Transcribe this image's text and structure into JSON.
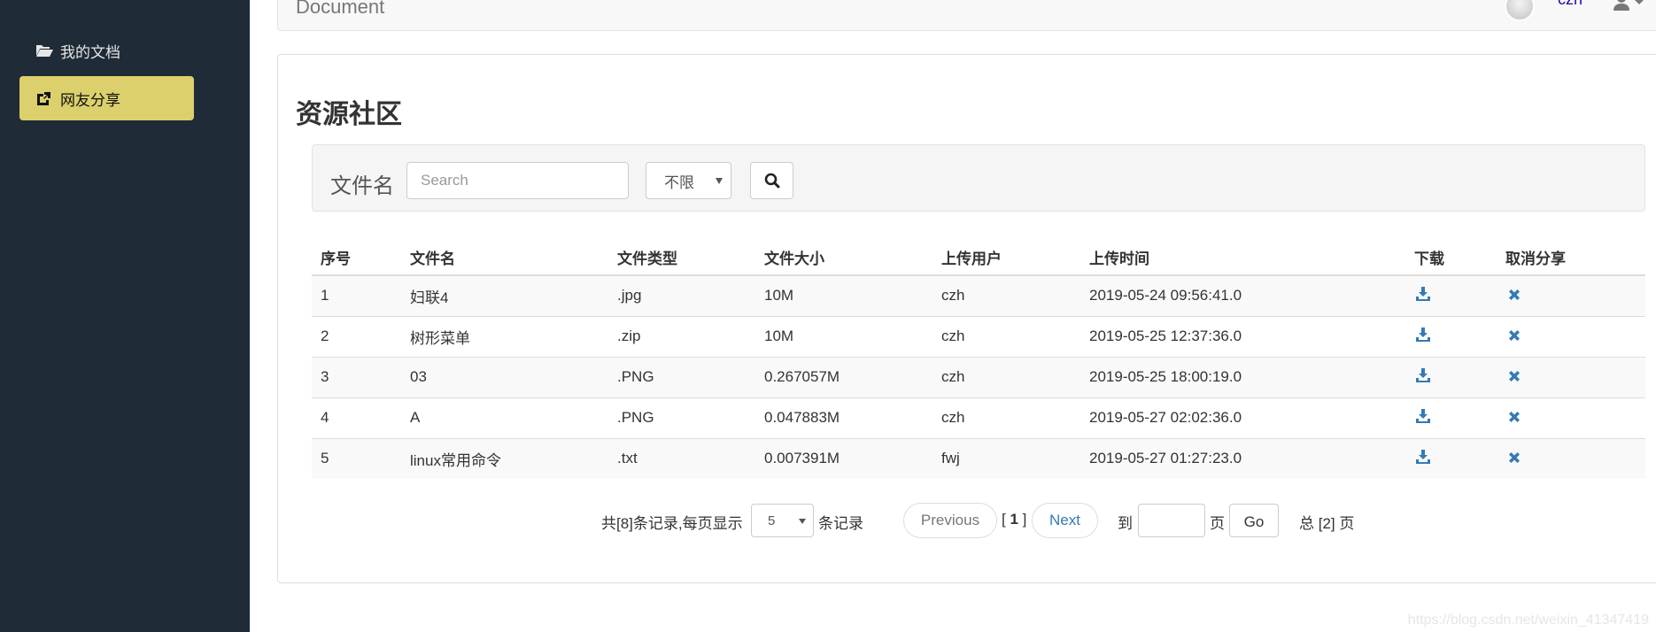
{
  "sidebar": {
    "items": [
      {
        "label": "我的文档",
        "icon": "folder-open-icon",
        "active": false
      },
      {
        "label": "网友分享",
        "icon": "share-icon",
        "active": true
      }
    ]
  },
  "navbar": {
    "brand": "Document",
    "username": "czh",
    "user_menu_icon": "user-icon"
  },
  "page": {
    "title": "资源社区"
  },
  "search": {
    "label": "文件名",
    "placeholder": "Search",
    "value": "",
    "type_filter": "不限",
    "button_icon": "search-icon"
  },
  "table": {
    "headers": [
      "序号",
      "文件名",
      "文件类型",
      "文件大小",
      "上传用户",
      "上传时间",
      "下载",
      "取消分享"
    ],
    "rows": [
      {
        "index": "1",
        "name": "妇联4",
        "type": ".jpg",
        "size": "10M",
        "user": "czh",
        "time": "2019-05-24 09:56:41.0"
      },
      {
        "index": "2",
        "name": "树形菜单",
        "type": ".zip",
        "size": "10M",
        "user": "czh",
        "time": "2019-05-25 12:37:36.0"
      },
      {
        "index": "3",
        "name": "03",
        "type": ".PNG",
        "size": "0.267057M",
        "user": "czh",
        "time": "2019-05-25 18:00:19.0"
      },
      {
        "index": "4",
        "name": "A",
        "type": ".PNG",
        "size": "0.047883M",
        "user": "czh",
        "time": "2019-05-27 02:02:36.0"
      },
      {
        "index": "5",
        "name": "linux常用命令",
        "type": ".txt",
        "size": "0.007391M",
        "user": "fwj",
        "time": "2019-05-27 01:27:23.0"
      }
    ],
    "download_icon": "download-icon",
    "unshare_icon": "remove-icon"
  },
  "pagination": {
    "total_text": "共[8]条记录,每页显示",
    "page_size": "5",
    "records_text": "条记录",
    "previous_label": "Previous",
    "current_page_prefix": "[ ",
    "current_page": "1",
    "current_page_suffix": " ]",
    "next_label": "Next",
    "goto_label": "到",
    "goto_value": "",
    "page_unit": "页",
    "go_label": "Go",
    "total_pages_text": "总 [2] 页"
  },
  "watermark": "https://blog.csdn.net/weixin_41347419",
  "colors": {
    "sidebar_bg": "#1f2b37",
    "sidebar_active": "#dcd06c",
    "link_blue": "#337ab7",
    "username_blue": "#1a0dab"
  }
}
